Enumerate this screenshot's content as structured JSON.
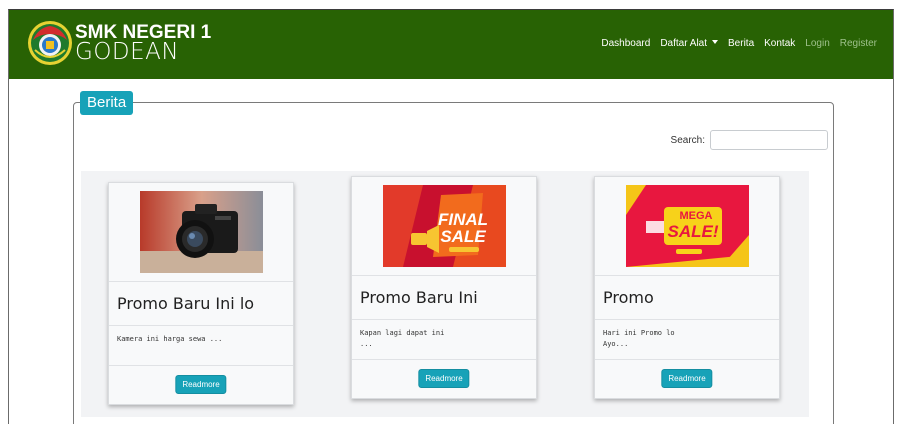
{
  "brand": {
    "line1": "SMK NEGERI 1",
    "line2": "GODEAN"
  },
  "nav": {
    "dashboard": "Dashboard",
    "daftar_alat": "Daftar Alat",
    "berita": "Berita",
    "kontak": "Kontak",
    "login": "Login",
    "register": "Register"
  },
  "section": {
    "title": "Berita"
  },
  "search": {
    "label": "Search:",
    "value": ""
  },
  "cards": [
    {
      "title": "Promo Baru Ini lo",
      "text": "Kamera ini harga sewa ...",
      "button": "Readmore",
      "image": "camera-photo"
    },
    {
      "title": "Promo Baru Ini",
      "text": "Kapan lagi dapat ini\n...",
      "button": "Readmore",
      "image": "final-sale-banner",
      "banner_top": "FINAL",
      "banner_bottom": "SALE"
    },
    {
      "title": "Promo",
      "text": "Hari ini Promo lo\nAyo...",
      "button": "Readmore",
      "image": "mega-sale-banner",
      "banner_top": "MEGA",
      "banner_bottom": "SALE!"
    }
  ],
  "colors": {
    "navbar": "#286204",
    "accent": "#17a2b8",
    "muted_nav": "#9dc08a"
  }
}
